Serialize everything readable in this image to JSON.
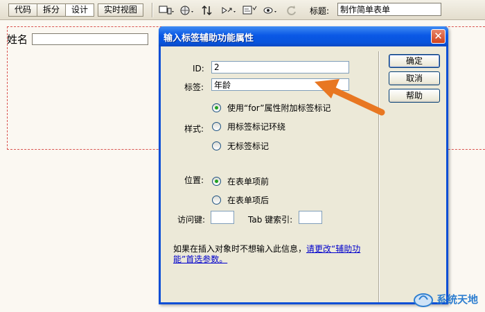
{
  "toolbar": {
    "view_buttons": [
      "代码",
      "拆分",
      "设计"
    ],
    "live_view": "实时视图",
    "icons": [
      "multiscreen-icon",
      "globe-icon",
      "file-transfer-icon",
      "debug-icon",
      "page-preview-icon",
      "visual-aids-icon",
      "refresh-icon"
    ],
    "title_label": "标题:",
    "title_value": "制作简单表单"
  },
  "canvas": {
    "name_label": "姓名"
  },
  "dialog": {
    "title": "输入标签辅助功能属性",
    "close": "✕",
    "id_label": "ID:",
    "id_value": "2",
    "label_label": "标签:",
    "label_value": "年龄",
    "style_label": "样式:",
    "style_options": [
      "使用“for”属性附加标签标记",
      "用标签标记环绕",
      "无标签标记"
    ],
    "style_selected": 0,
    "position_label": "位置:",
    "position_options": [
      "在表单项前",
      "在表单项后"
    ],
    "position_selected": 0,
    "access_key_label": "访问键:",
    "tab_index_label": "Tab 键索引:",
    "help_text": "如果在插入对象时不想输入此信息，",
    "help_link": "请更改“辅助功能”首选参数。",
    "buttons": {
      "ok": "确定",
      "cancel": "取消",
      "help": "帮助"
    }
  },
  "watermark": {
    "text": "系统天地"
  },
  "colors": {
    "titlebar": "#0a58e6",
    "arrow": "#e87722",
    "dialog_bg": "#ece9d8",
    "form_border": "#d9534f"
  }
}
